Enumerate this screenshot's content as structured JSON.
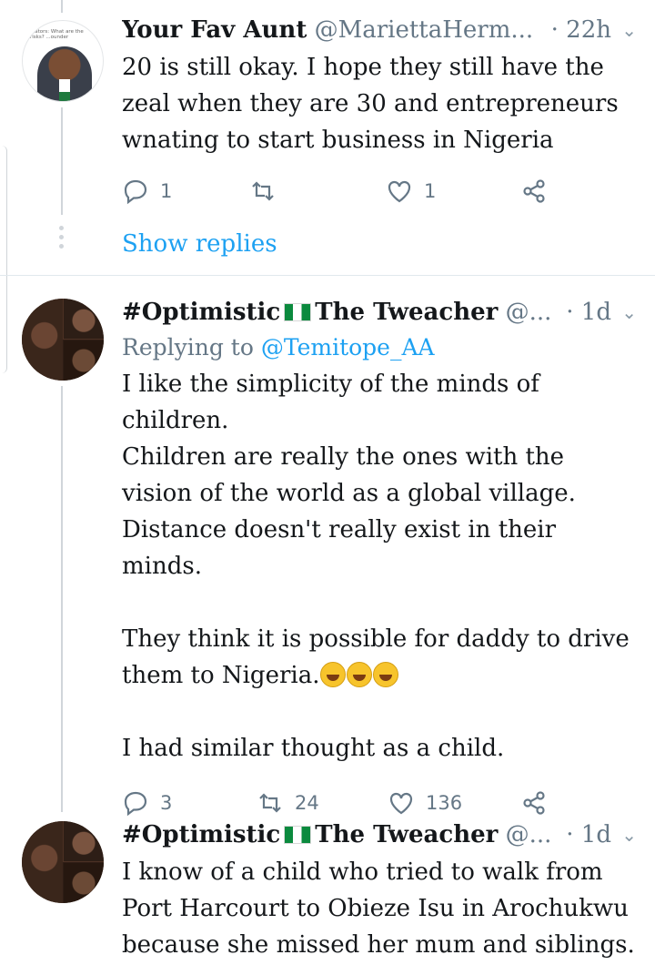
{
  "tweets": [
    {
      "name": "Your Fav Aunt",
      "handle": "@MariettaHerm...",
      "time": "· 22h",
      "avatar_caption": "...ators: What are the risks? ...ounder",
      "body": "20 is still okay. I hope they still have the zeal when they are 30 and entrepreneurs wnating to start business in Nigeria",
      "actions": {
        "reply": "1",
        "retweet": "",
        "like": "1"
      },
      "show_replies": "Show replies"
    },
    {
      "name_prefix": "#Optimistic",
      "name_suffix": "The Tweacher",
      "handle": "@...",
      "time": "· 1d",
      "replying_label": "Replying to",
      "replying_handle": "@Temitope_AA",
      "body_p1": "I like the simplicity of the minds of children.\nChildren are really the ones with the vision of the world as a global village. Distance doesn't really exist in their minds.",
      "body_p2": "They think it is possible for daddy to drive them to Nigeria.",
      "body_p3": "I had similar thought as a child.",
      "actions": {
        "reply": "3",
        "retweet": "24",
        "like": "136"
      }
    },
    {
      "name_prefix": "#Optimistic",
      "name_suffix": "The Tweacher",
      "handle": "@...",
      "time": "· 1d",
      "body": "I know of a child who tried to walk from Port Harcourt to Obieze Isu in Arochukwu because she missed her mum and siblings."
    }
  ],
  "colors": {
    "link": "#1da1f2",
    "muted": "#657786",
    "text": "#14171a",
    "divider": "#e1e8ed"
  },
  "icons": [
    "reply-icon",
    "retweet-icon",
    "like-icon",
    "share-icon",
    "caret-down-icon",
    "nigeria-flag-icon",
    "laughing-tears-emoji-icon"
  ]
}
